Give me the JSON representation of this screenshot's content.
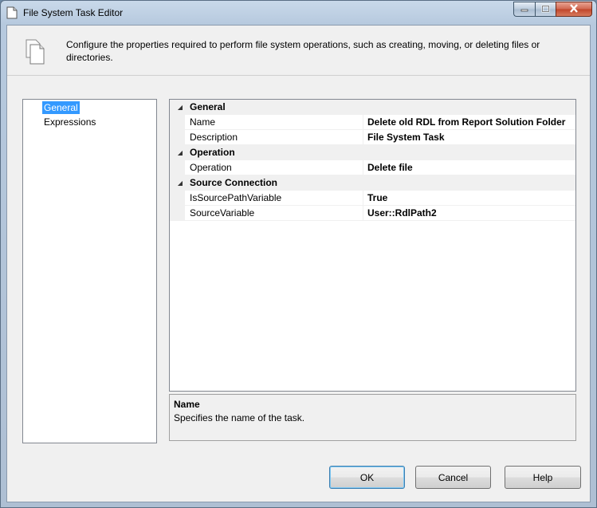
{
  "window": {
    "title": "File System Task Editor",
    "caption_buttons": [
      "minimize-icon",
      "maximize-icon",
      "close-icon"
    ]
  },
  "header": {
    "text": "Configure the properties required to perform file system operations, such as creating, moving, or deleting files or directories."
  },
  "nav": {
    "items": [
      {
        "label": "General",
        "selected": true
      },
      {
        "label": "Expressions",
        "selected": false
      }
    ]
  },
  "grid": {
    "categories": [
      {
        "label": "General",
        "props": [
          {
            "name": "Name",
            "value": "Delete old RDL from Report Solution Folder"
          },
          {
            "name": "Description",
            "value": "File System Task"
          }
        ]
      },
      {
        "label": "Operation",
        "props": [
          {
            "name": "Operation",
            "value": "Delete file"
          }
        ]
      },
      {
        "label": "Source Connection",
        "props": [
          {
            "name": "IsSourcePathVariable",
            "value": "True"
          },
          {
            "name": "SourceVariable",
            "value": "User::RdlPath2"
          }
        ]
      }
    ]
  },
  "description": {
    "title": "Name",
    "text": "Specifies the name of the task."
  },
  "buttons": {
    "ok": "OK",
    "cancel": "Cancel",
    "help": "Help"
  },
  "colors": {
    "selection": "#3399ff",
    "category_bg": "#f0f0f0",
    "dialog_bg": "#f0f0f0"
  }
}
